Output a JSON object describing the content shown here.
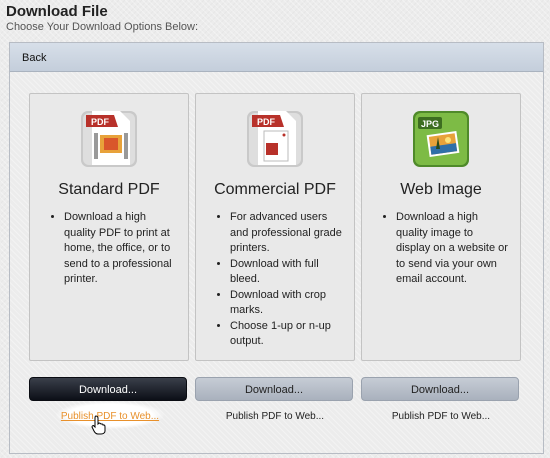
{
  "header": {
    "title": "Download File",
    "subtitle": "Choose Your Download Options Below:"
  },
  "back_label": "Back",
  "options": [
    {
      "name": "Standard PDF",
      "icon": "pdf-icon",
      "bullets": [
        "Download a high quality PDF to print at home, the office, or to send to a professional printer."
      ],
      "button_label": "Download...",
      "publish_label": "Publish PDF to Web..."
    },
    {
      "name": "Commercial PDF",
      "icon": "commercial-pdf-icon",
      "bullets": [
        "For advanced users and professional grade printers.",
        "Download with full bleed.",
        "Download with crop marks.",
        "Choose 1-up or n-up output."
      ],
      "button_label": "Download...",
      "publish_label": "Publish PDF to Web..."
    },
    {
      "name": "Web Image",
      "icon": "jpg-icon",
      "bullets": [
        "Download a high quality image to display on a website or to send via your own email account."
      ],
      "button_label": "Download...",
      "publish_label": "Publish PDF to Web..."
    }
  ],
  "colors": {
    "pdf_red": "#b8312a",
    "jpg_green": "#6aa83a",
    "publish_link_hover": "#e8902b",
    "primary_button": "#0c0f17"
  }
}
